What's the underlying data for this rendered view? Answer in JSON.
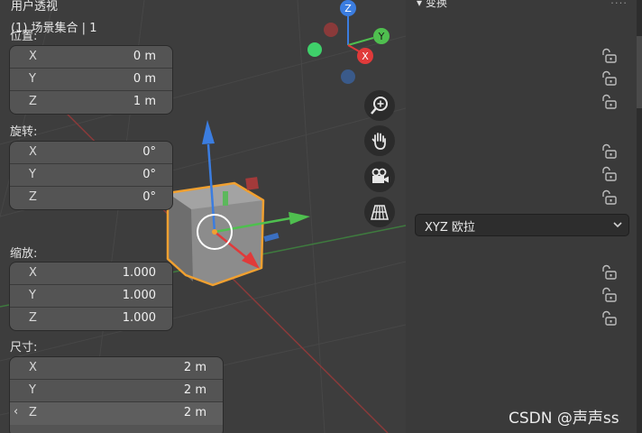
{
  "viewport": {
    "view_name": "用户透视",
    "collection": "(1) 场景集合 | 1",
    "gizmo": {
      "z_label": "Z",
      "y_label": "Y",
      "x_label": "X"
    },
    "nav_icons": [
      "zoom-icon",
      "hand-icon",
      "camera-icon",
      "grid-icon"
    ]
  },
  "panel": {
    "header_title": "变换",
    "header_menu": "::::",
    "location": {
      "label": "位置:",
      "rows": [
        {
          "axis": "X",
          "value": "0 m"
        },
        {
          "axis": "Y",
          "value": "0 m"
        },
        {
          "axis": "Z",
          "value": "1 m"
        }
      ]
    },
    "rotation": {
      "label": "旋转:",
      "rows": [
        {
          "axis": "X",
          "value": "0°"
        },
        {
          "axis": "Y",
          "value": "0°"
        },
        {
          "axis": "Z",
          "value": "0°"
        }
      ],
      "mode": "XYZ 欧拉"
    },
    "scale": {
      "label": "缩放:",
      "rows": [
        {
          "axis": "X",
          "value": "1.000"
        },
        {
          "axis": "Y",
          "value": "1.000"
        },
        {
          "axis": "Z",
          "value": "1.000"
        }
      ]
    },
    "dimensions": {
      "label": "尺寸:",
      "rows": [
        {
          "axis": "X",
          "value": "2 m"
        },
        {
          "axis": "Y",
          "value": "2 m"
        },
        {
          "axis": "Z",
          "value": "2 m",
          "left_arrow": "‹"
        }
      ]
    }
  },
  "watermark": "CSDN @声声ss",
  "colors": {
    "x_axis": "#e03a3a",
    "y_axis": "#4fbf4f",
    "z_axis": "#3b7de0",
    "selection": "#f0a030"
  }
}
